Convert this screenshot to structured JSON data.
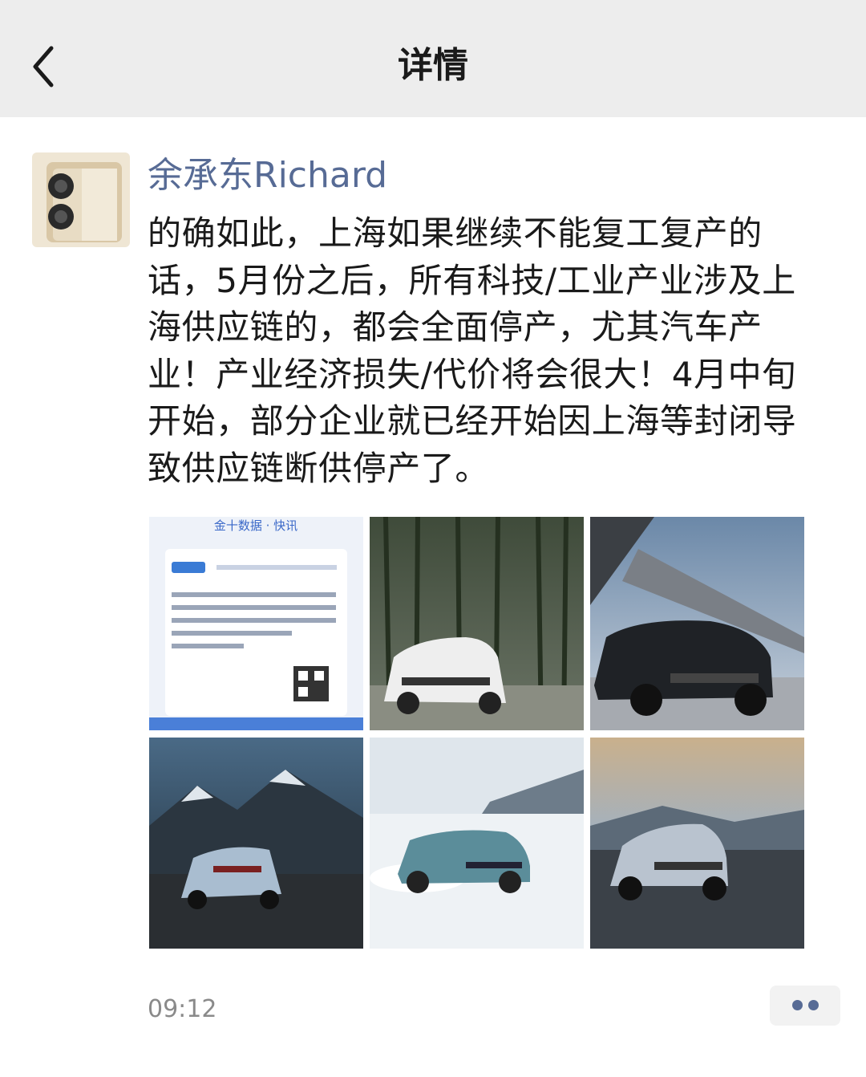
{
  "nav": {
    "title": "详情",
    "back_icon": "chevron-left-icon"
  },
  "post": {
    "author": "余承东Richard",
    "text": "的确如此，上海如果继续不能复工复产的话，5月份之后，所有科技/工业产业涉及上海供应链的，都会全面停产，尤其汽车产业！产业经济损失/代价将会很大！4月中旬开始，部分企业就已经开始因上海等封闭导致供应链断供停产了。",
    "time": "09:12",
    "more_icon": "more-dots-icon",
    "images": [
      {
        "kind": "news-screenshot",
        "headline": "金十数据 · 快讯"
      },
      {
        "kind": "photo",
        "subject": "white SUV in bamboo forest"
      },
      {
        "kind": "photo",
        "subject": "black SUV at modern building"
      },
      {
        "kind": "photo",
        "subject": "blue SUV on mountain road"
      },
      {
        "kind": "photo",
        "subject": "teal SUV drifting on snow"
      },
      {
        "kind": "photo",
        "subject": "silver SUV on highway"
      }
    ]
  },
  "colors": {
    "nav_bg": "#ededed",
    "author": "#576b95",
    "text": "#1a1a1a",
    "time": "#8a8a8a"
  }
}
